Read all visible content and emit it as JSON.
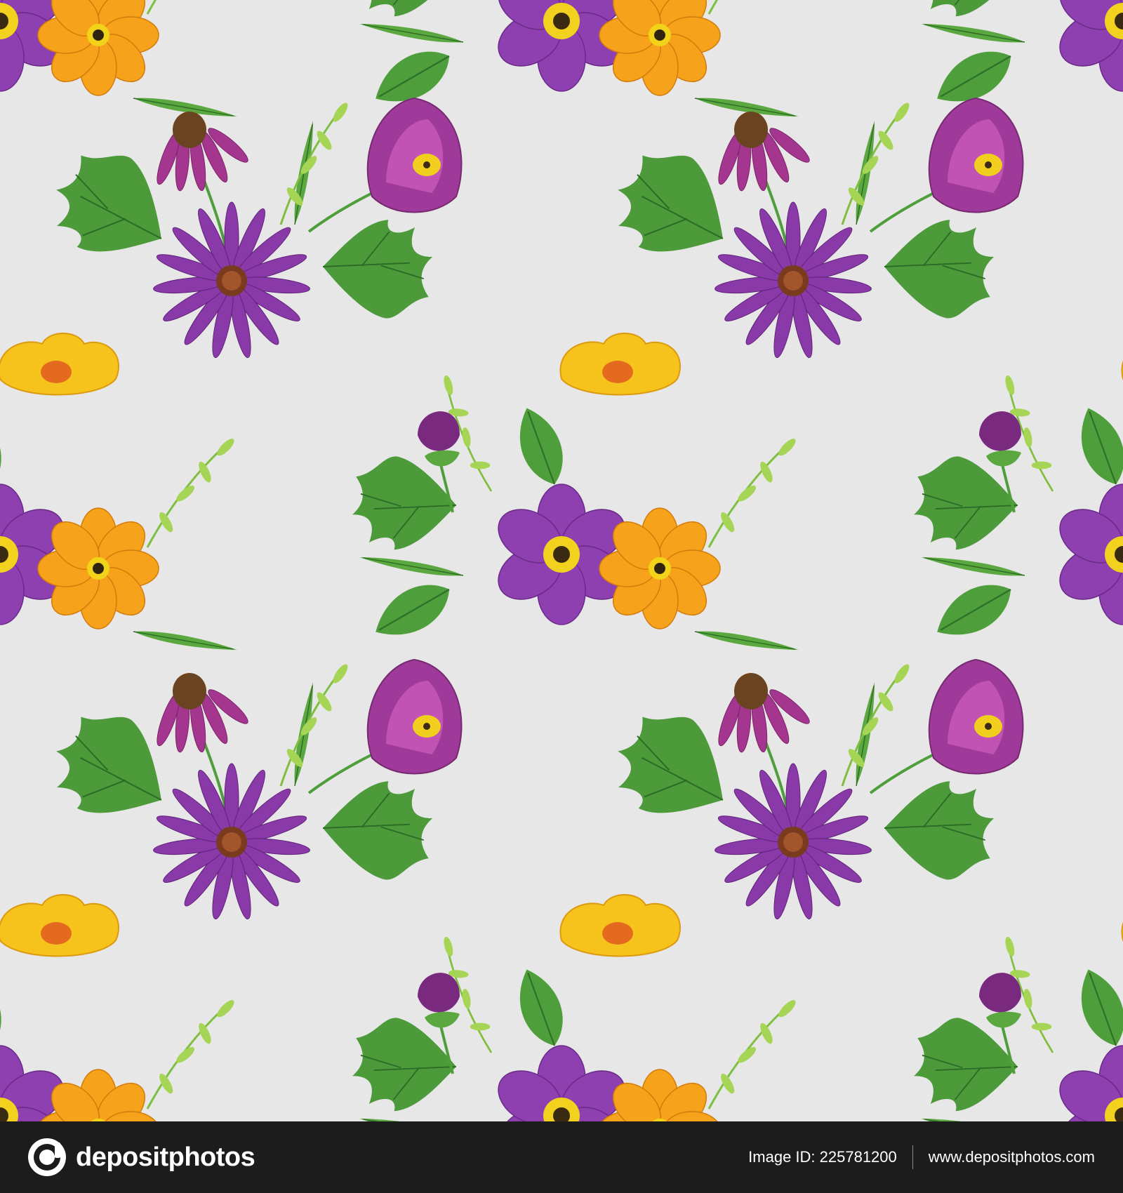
{
  "footer": {
    "brand_name": "depositphotos",
    "image_id": "Image ID: 225781200",
    "site_url": "www.depositphotos.com"
  },
  "colors": {
    "background": "#e7e7e7",
    "footer": "#1c1c1c",
    "violet": "#8e3fb0",
    "magenta": "#a5368f",
    "orange": "#f6a21a",
    "yellow": "#f6c21c",
    "leaf": "#4f9e3c",
    "leaf_light": "#9ccc4f"
  },
  "icons": {
    "brand": "depositphotos-logo-icon"
  }
}
